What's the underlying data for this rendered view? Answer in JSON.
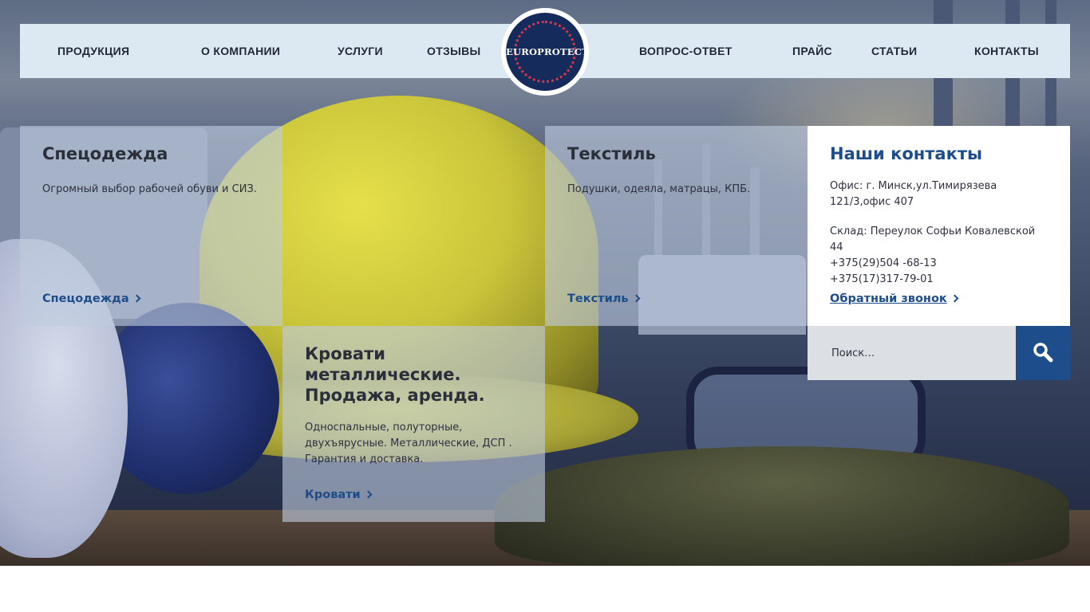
{
  "nav": {
    "items": [
      "ПРОДУКЦИЯ",
      "О КОМПАНИИ",
      "УСЛУГИ",
      "ОТЗЫВЫ",
      "ВОПРОС-ОТВЕТ",
      "ПРАЙС",
      "СТАТЬИ",
      "КОНТАКТЫ"
    ]
  },
  "logo": {
    "text": "EUROPROTECT"
  },
  "tiles": {
    "workwear": {
      "title": "Спецодежда",
      "description": "Огромный выбор рабочей обуви и СИЗ.",
      "link": "Спецодежда"
    },
    "beds": {
      "title": "Кровати металлические. Продажа, аренда.",
      "description": "Односпальные, полуторные, двухъярусные. Металлические, ДСП . Гарантия и доставка.",
      "link": "Кровати"
    },
    "textile": {
      "title": "Текстиль",
      "description": "Подушки, одеяла, матрацы, КПБ.",
      "link": "Текстиль"
    }
  },
  "contacts": {
    "title": "Наши контакты",
    "office": "Офис: г. Минск,ул.Тимирязева 121/3,офис 407",
    "warehouse": "Склад: Переулок Софьи Ковалевской 44",
    "phone1": "+375(29)504 -68-13",
    "phone2": "+375(17)317-79-01",
    "callback": "Обратный звонок"
  },
  "search": {
    "placeholder": "Поиск…",
    "icon": "search-icon"
  },
  "colors": {
    "accent": "#1d4d8a",
    "nav_bg": "#dde9f2",
    "tile_bg": "#becbde"
  }
}
